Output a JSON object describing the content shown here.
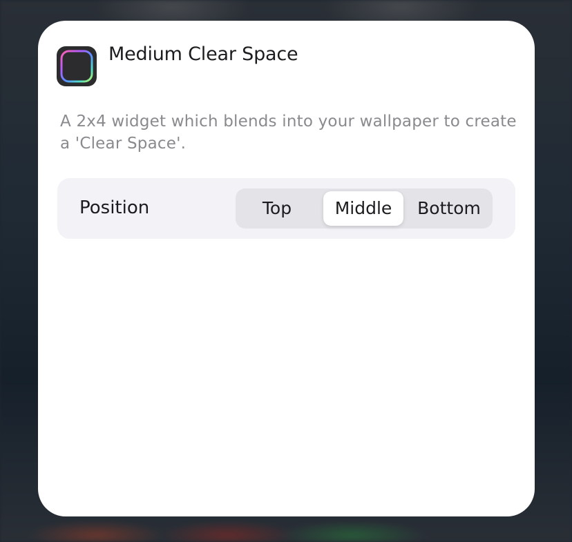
{
  "widget": {
    "title": "Medium Clear Space",
    "description": "A 2x4 widget which blends into your wallpaper to create a 'Clear Space'.",
    "icon": "clear-space-app-icon"
  },
  "settings": {
    "position": {
      "label": "Position",
      "options": [
        "Top",
        "Middle",
        "Bottom"
      ],
      "selected": "Middle"
    }
  },
  "colors": {
    "sheet_background": "#ffffff",
    "row_background": "#f2f2f7",
    "segmented_background": "#e3e3e8",
    "selected_segment": "#ffffff",
    "description_text": "#8a8a8e"
  }
}
